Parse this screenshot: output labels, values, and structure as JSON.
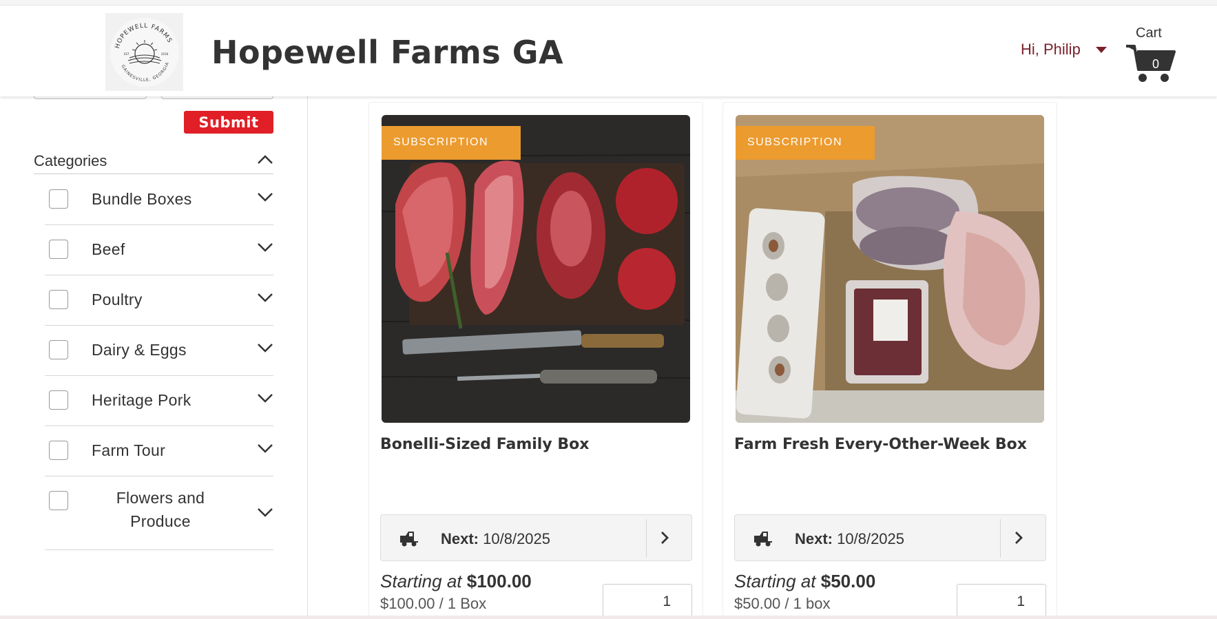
{
  "header": {
    "logo_text": "HOPEWELL FARMS · EST 2018 · GAINESVILLE, GEORGIA",
    "title": "Hopewell Farms GA",
    "greeting": "Hi, Philip",
    "cart_label": "Cart",
    "cart_count": "0"
  },
  "sidebar": {
    "submit_label": "Submit",
    "categories_title": "Categories",
    "categories": [
      {
        "label": "Bundle Boxes"
      },
      {
        "label": "Beef"
      },
      {
        "label": "Poultry"
      },
      {
        "label": "Dairy & Eggs"
      },
      {
        "label": "Heritage Pork"
      },
      {
        "label": "Farm Tour"
      },
      {
        "label": "Flowers and Produce"
      }
    ]
  },
  "products": [
    {
      "badge": "SUBSCRIPTION",
      "title": "Bonelli-Sized Family Box",
      "next_label": "Next:",
      "next_date": "10/8/2025",
      "starting_label": "Starting at",
      "price": "$100.00",
      "unit_price": "$100.00 / 1 Box",
      "quantity": "1"
    },
    {
      "badge": "SUBSCRIPTION",
      "title": "Farm Fresh Every-Other-Week Box",
      "next_label": "Next:",
      "next_date": "10/8/2025",
      "starting_label": "Starting at",
      "price": "$50.00",
      "unit_price": "$50.00 / 1 box",
      "quantity": "1"
    }
  ],
  "colors": {
    "accent_red": "#e01f26",
    "badge_orange": "#ec9b2f",
    "greeting_maroon": "#7a1f2b"
  },
  "icons": [
    "cart-icon",
    "caret-down-icon",
    "chevron-up-icon",
    "chevron-down-icon",
    "truck-icon",
    "chevron-right-icon"
  ]
}
